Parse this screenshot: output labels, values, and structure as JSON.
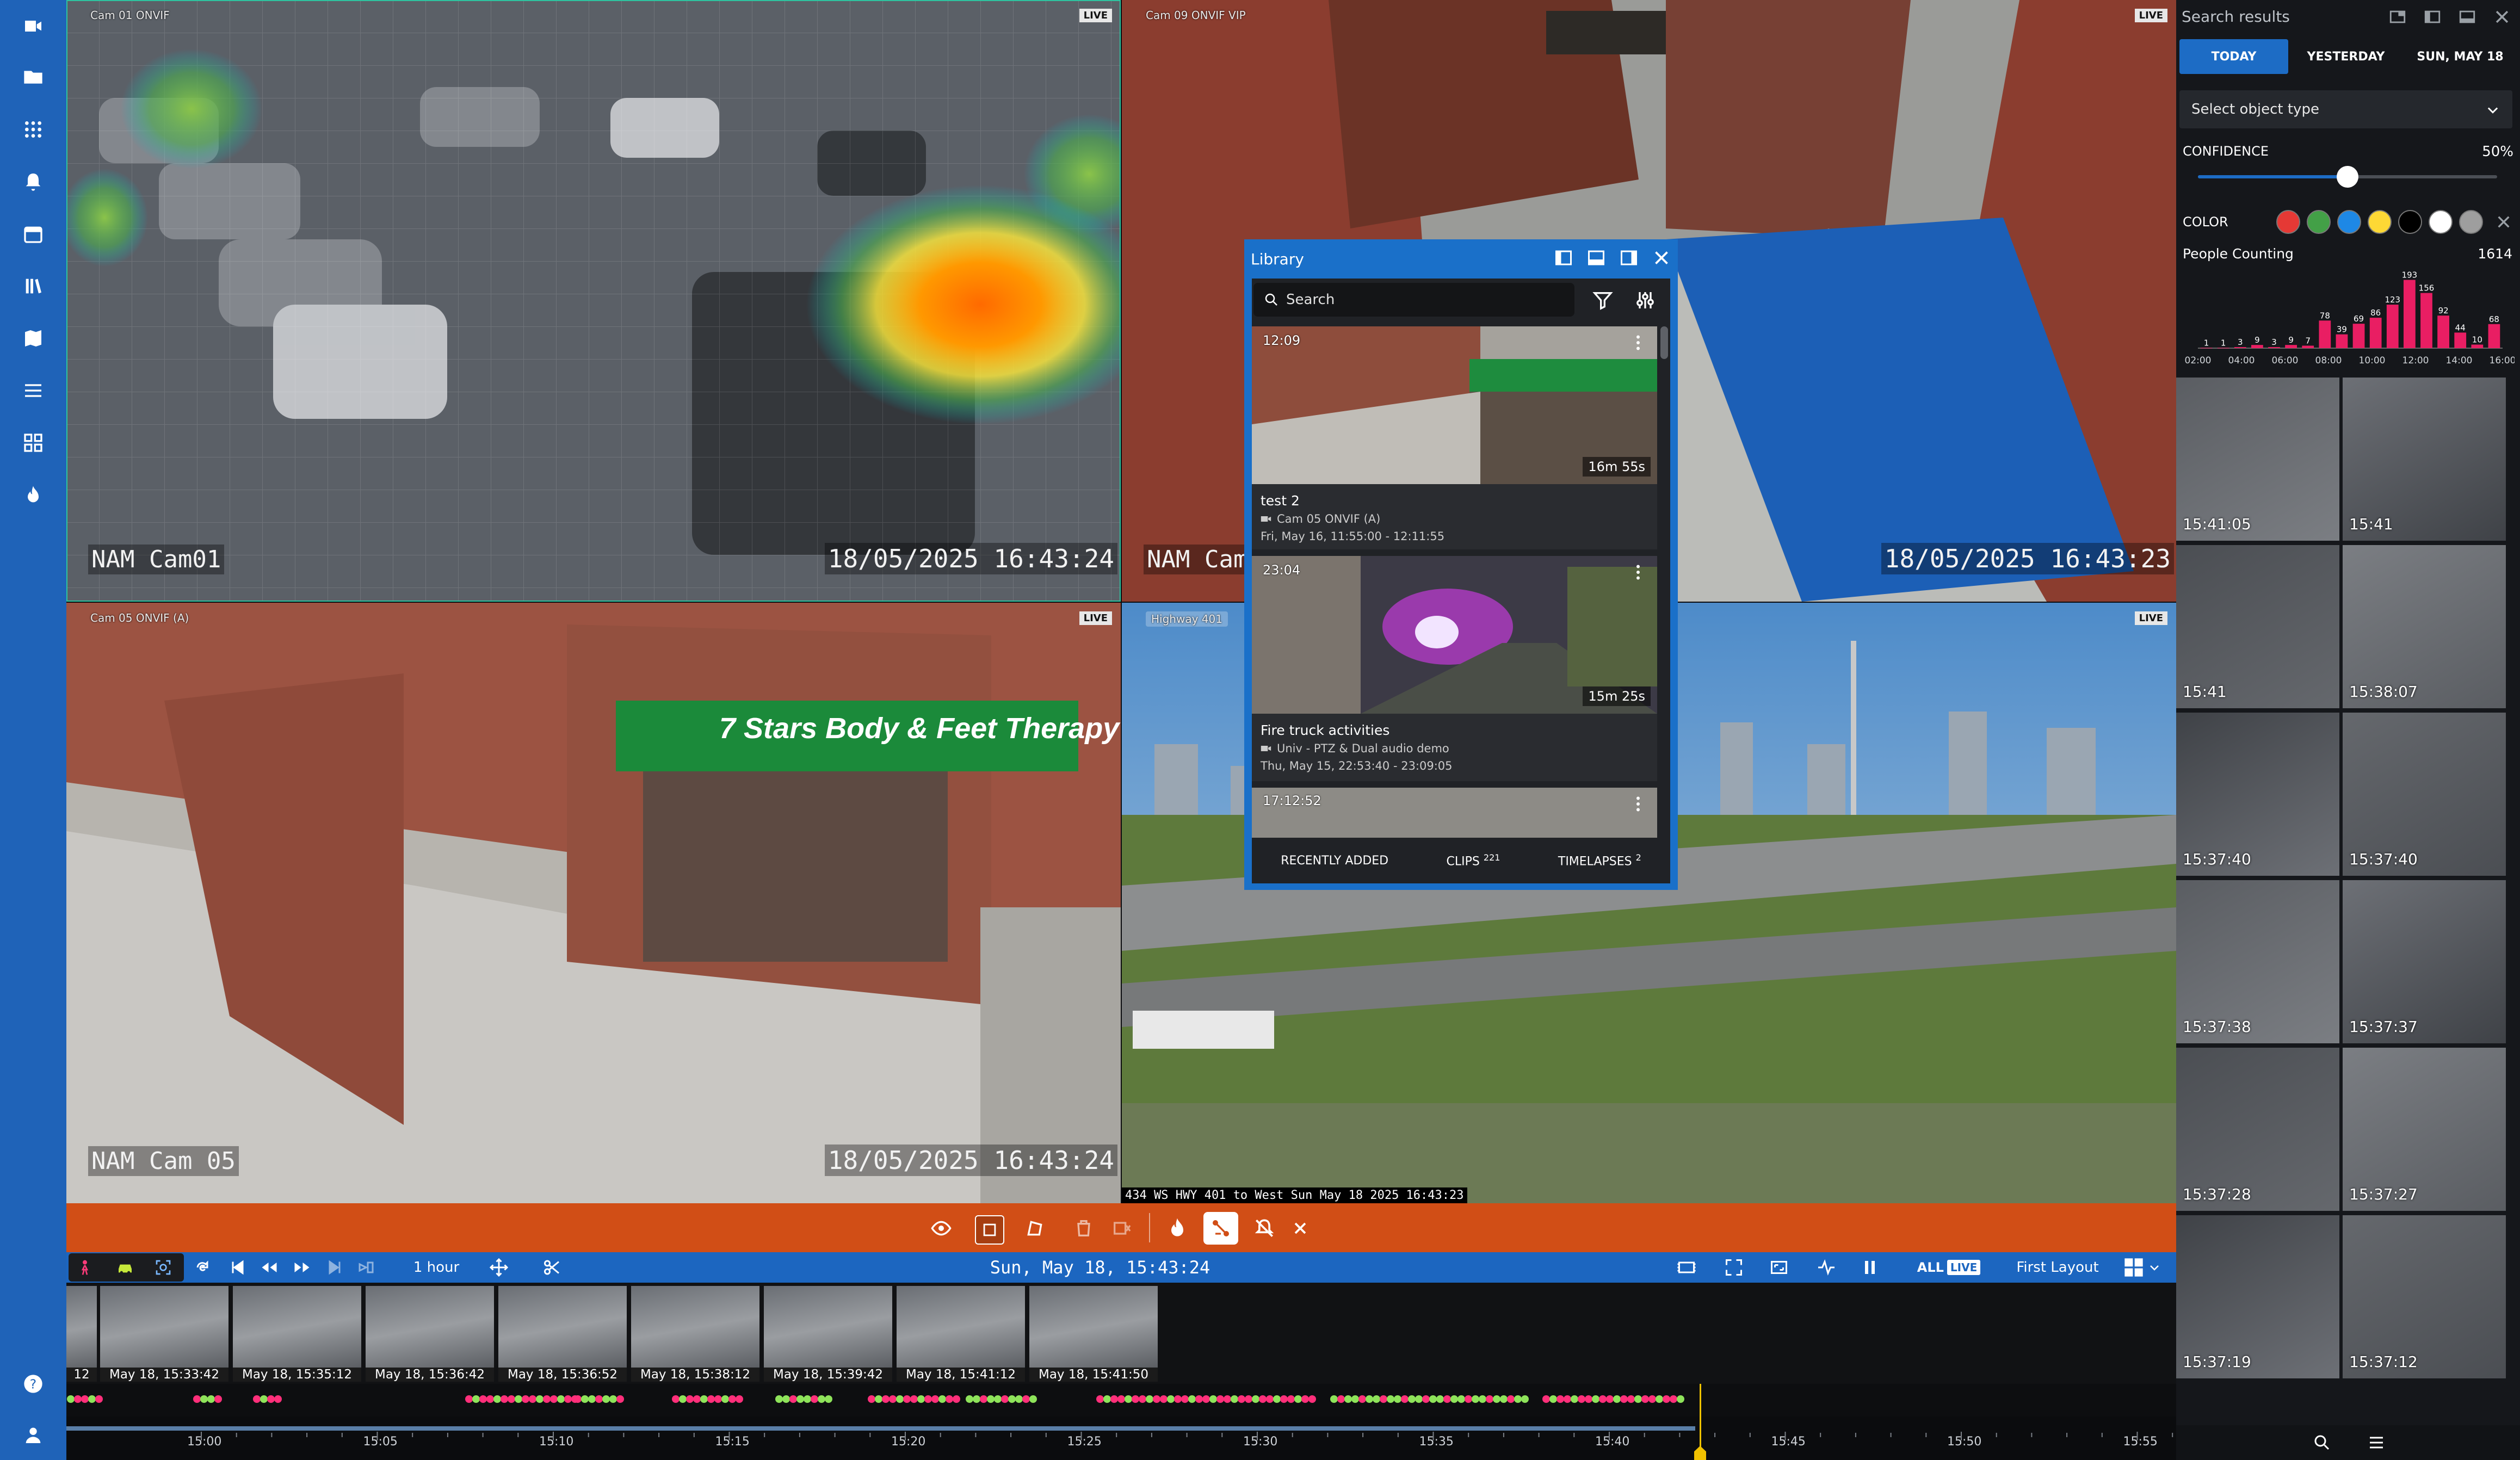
{
  "cameras": [
    {
      "id": "cam01",
      "name": "Cam 01 ONVIF",
      "live": "LIVE",
      "osd_name": "NAM Cam01",
      "osd_time": "18/05/2025 16:43:24"
    },
    {
      "id": "cam09",
      "name": "Cam 09 ONVIF VIP",
      "live": "LIVE",
      "osd_name": "NAM Cam",
      "osd_time": "18/05/2025 16:43:23"
    },
    {
      "id": "cam05",
      "name": "Cam 05 ONVIF (A)",
      "live": "LIVE",
      "osd_name": "NAM Cam 05",
      "osd_time": "18/05/2025 16:43:24",
      "sign": "7 Stars Body & Feet Therapy"
    },
    {
      "id": "hwy401",
      "name": "Highway 401",
      "live": "LIVE",
      "overlay_text": "434 WS HWY 401 to West Sun May 18 2025 16:43:23"
    }
  ],
  "library": {
    "title": "Library",
    "search_placeholder": "Search",
    "items": [
      {
        "time": "12:09",
        "duration": "16m 55s",
        "title": "test 2",
        "camera": "Cam 05 ONVIF (A)",
        "range": "Fri, May 16, 11:55:00 - 12:11:55"
      },
      {
        "time": "23:04",
        "duration": "15m 25s",
        "title": "Fire truck activities",
        "camera": "Univ - PTZ & Dual audio demo",
        "range": "Thu, May 15, 22:53:40 - 23:09:05"
      },
      {
        "time": "17:12:52"
      }
    ],
    "tabs": [
      {
        "label": "RECENTLY ADDED",
        "count": ""
      },
      {
        "label": "CLIPS",
        "count": "221"
      },
      {
        "label": "TIMELAPSES",
        "count": "2"
      }
    ]
  },
  "search": {
    "title": "Search results",
    "days": [
      "TODAY",
      "YESTERDAY",
      "SUN, MAY 18"
    ],
    "object_type_placeholder": "Select object type",
    "confidence_label": "CONFIDENCE",
    "confidence_value": "50%",
    "confidence_fraction": 0.5,
    "color_label": "COLOR",
    "colors": [
      "#e53935",
      "#43a047",
      "#1e88e5",
      "#fdd835",
      "#000000",
      "#ffffff",
      "#9e9e9e"
    ],
    "counting_label": "People Counting",
    "counting_value": "1614",
    "results": [
      {
        "time": "15:41:05"
      },
      {
        "time": "15:41"
      },
      {
        "time": "15:41"
      },
      {
        "time": "15:38:07"
      },
      {
        "time": "15:37:40"
      },
      {
        "time": "15:37:40"
      },
      {
        "time": "15:37:38"
      },
      {
        "time": "15:37:37"
      },
      {
        "time": "15:37:28"
      },
      {
        "time": "15:37:27"
      },
      {
        "time": "15:37:19"
      },
      {
        "time": "15:37:12"
      }
    ]
  },
  "chart_data": {
    "type": "bar",
    "title": "People Counting",
    "x_ticks": [
      "02:00",
      "04:00",
      "06:00",
      "08:00",
      "10:00",
      "12:00",
      "14:00",
      "16:00"
    ],
    "labels": [
      "1",
      "1",
      "3",
      "9",
      "3",
      "9",
      "7",
      "78",
      "39",
      "69",
      "86",
      "123",
      "193",
      "156",
      "92",
      "44",
      "10",
      "68"
    ],
    "values": [
      1,
      1,
      3,
      9,
      3,
      9,
      7,
      78,
      39,
      69,
      86,
      123,
      193,
      156,
      92,
      44,
      10,
      68
    ],
    "ylim": [
      0,
      200
    ],
    "color": "#e91e63"
  },
  "control": {
    "period": "1 hour",
    "datetime": "Sun, May 18, 15:43:24",
    "all_label": "ALL",
    "live_label": "LIVE",
    "layout_label": "First Layout"
  },
  "film": [
    {
      "label": "12"
    },
    {
      "label": "May 18, 15:33:42"
    },
    {
      "label": "May 18, 15:35:12"
    },
    {
      "label": "May 18, 15:36:42"
    },
    {
      "label": "May 18, 15:36:52"
    },
    {
      "label": "May 18, 15:38:12"
    },
    {
      "label": "May 18, 15:39:42"
    },
    {
      "label": "May 18, 15:41:12"
    },
    {
      "label": "May 18, 15:41:50"
    }
  ],
  "timeline": {
    "ticks": [
      "15:00",
      "15:05",
      "15:10",
      "15:15",
      "15:20",
      "15:25",
      "15:30",
      "15:35",
      "15:40",
      "15:45",
      "15:50",
      "15:55"
    ]
  }
}
